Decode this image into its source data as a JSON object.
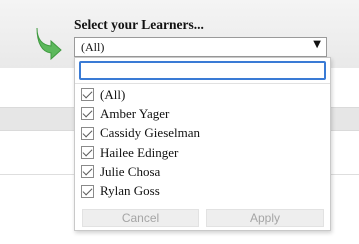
{
  "filter": {
    "title": "Select your Learners...",
    "selected_value": "(All)",
    "caret": "▼",
    "search_value": "",
    "options": [
      {
        "label": "(All)",
        "checked": true
      },
      {
        "label": "Amber Yager",
        "checked": true
      },
      {
        "label": "Cassidy Gieselman",
        "checked": true
      },
      {
        "label": "Hailee Edinger",
        "checked": true
      },
      {
        "label": "Julie Chosa",
        "checked": true
      },
      {
        "label": "Rylan Goss",
        "checked": true
      }
    ],
    "cancel_label": "Cancel",
    "apply_label": "Apply"
  },
  "icons": {
    "arrow": "curved-down-right-arrow-icon",
    "checkbox": "checkmark-icon"
  },
  "colors": {
    "arrow": "#5cb85c",
    "search_focus": "#3a7bd5",
    "disabled_text": "#a5a5a5"
  }
}
